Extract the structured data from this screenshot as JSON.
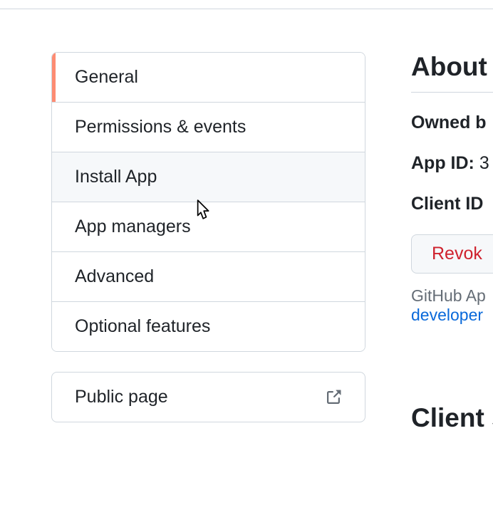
{
  "sidebar": {
    "items": [
      {
        "label": "General",
        "selected": true,
        "hovered": false
      },
      {
        "label": "Permissions & events",
        "selected": false,
        "hovered": false
      },
      {
        "label": "Install App",
        "selected": false,
        "hovered": true
      },
      {
        "label": "App managers",
        "selected": false,
        "hovered": false
      },
      {
        "label": "Advanced",
        "selected": false,
        "hovered": false
      },
      {
        "label": "Optional features",
        "selected": false,
        "hovered": false
      }
    ],
    "public_page_label": "Public page"
  },
  "main": {
    "about_heading": "About",
    "owned_by_label": "Owned b",
    "app_id_label": "App ID:",
    "app_id_value": "3",
    "client_id_label": "Client ID",
    "revoke_label": "Revok",
    "note_prefix": "GitHub Ap",
    "note_link": "developer",
    "client_secrets_heading": "Client s"
  }
}
